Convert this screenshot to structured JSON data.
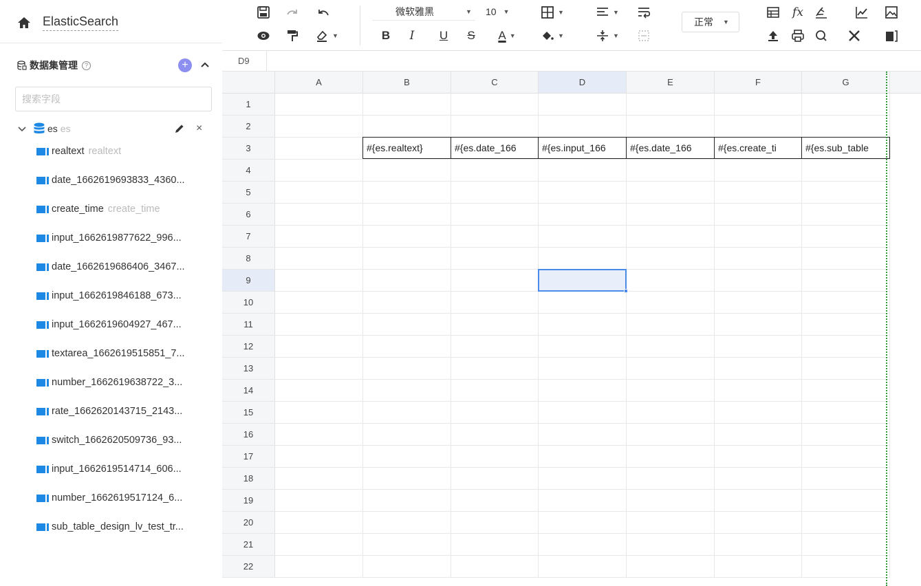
{
  "app": {
    "title": "ElasticSearch"
  },
  "dataset": {
    "title": "数据集管理",
    "help_icon": "question-circle-icon",
    "add_icon": "plus-circle-icon",
    "search_placeholder": "搜索字段",
    "source": {
      "name": "es",
      "alias": "es"
    },
    "fields": [
      {
        "name": "realtext",
        "alias": "realtext"
      },
      {
        "name": "date_1662619693833_4360...",
        "alias": ""
      },
      {
        "name": "create_time",
        "alias": "create_time"
      },
      {
        "name": "input_1662619877622_996...",
        "alias": ""
      },
      {
        "name": "date_1662619686406_3467...",
        "alias": ""
      },
      {
        "name": "input_1662619846188_673...",
        "alias": ""
      },
      {
        "name": "input_1662619604927_467...",
        "alias": ""
      },
      {
        "name": "textarea_1662619515851_7...",
        "alias": ""
      },
      {
        "name": "number_1662619638722_3...",
        "alias": ""
      },
      {
        "name": "rate_1662620143715_2143...",
        "alias": ""
      },
      {
        "name": "switch_1662620509736_93...",
        "alias": ""
      },
      {
        "name": "input_1662619514714_606...",
        "alias": ""
      },
      {
        "name": "number_1662619517124_6...",
        "alias": ""
      },
      {
        "name": "sub_table_design_lv_test_tr...",
        "alias": ""
      }
    ]
  },
  "toolbar": {
    "font": "微软雅黑",
    "font_size": "10",
    "text_style": "正常",
    "colors": {
      "accent": "#4a8ae8",
      "add_button": "#8c8ef0",
      "db_icon": "#1e88e5",
      "print_edge": "#2e9b3a"
    }
  },
  "formula_bar": {
    "cell_ref": "D9"
  },
  "sheet": {
    "columns": [
      "A",
      "B",
      "C",
      "D",
      "E",
      "F",
      "G"
    ],
    "rows": [
      "1",
      "2",
      "3",
      "4",
      "5",
      "6",
      "7",
      "8",
      "9",
      "10",
      "11",
      "12",
      "13",
      "14",
      "15",
      "16",
      "17",
      "18",
      "19",
      "20",
      "21",
      "22"
    ],
    "active_column": "D",
    "active_row": "9",
    "row3_cells": [
      "#{es.realtext}",
      "#{es.date_166",
      "#{es.input_166",
      "#{es.date_166",
      "#{es.create_ti",
      "#{es.sub_table"
    ]
  }
}
